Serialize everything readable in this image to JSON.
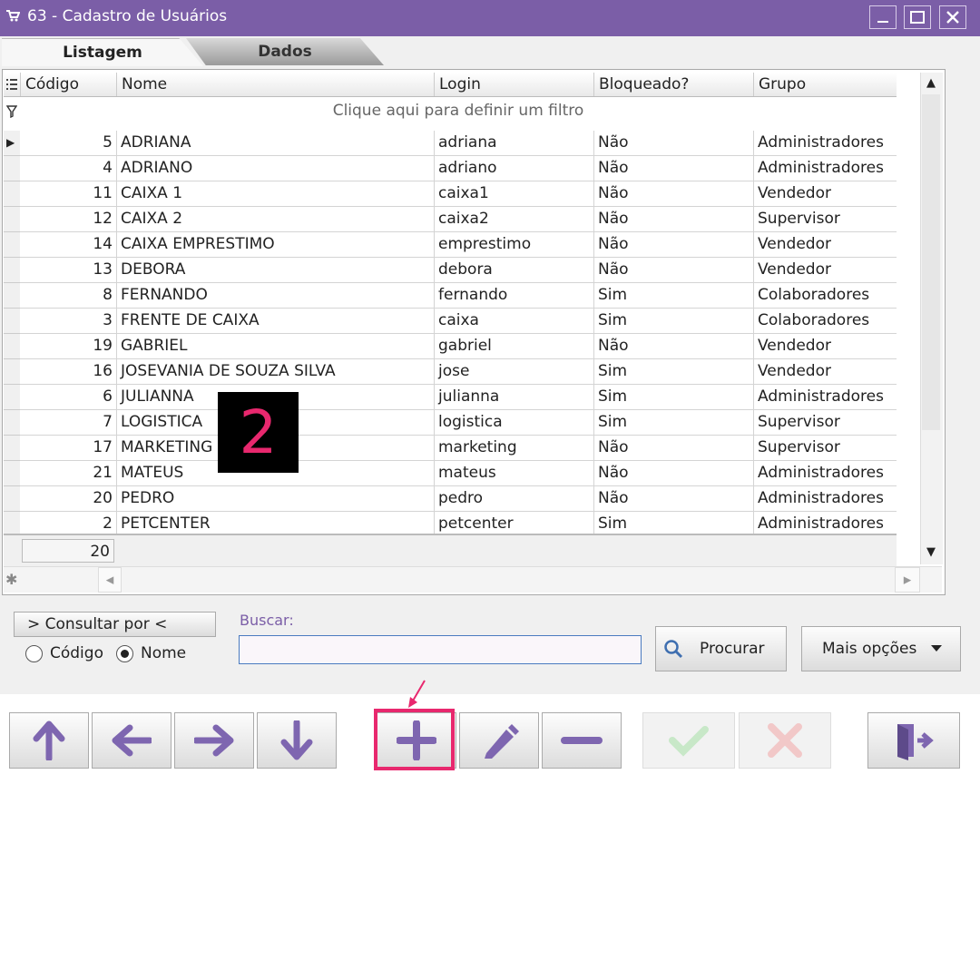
{
  "window": {
    "title": "63 - Cadastro de Usuários",
    "minimize_glyph": "▁",
    "maximize_glyph": "☐",
    "close_glyph": "✕"
  },
  "tabs": [
    {
      "label": "Listagem",
      "active": true
    },
    {
      "label": "Dados",
      "active": false
    }
  ],
  "grid": {
    "columns": [
      "Código",
      "Nome",
      "Login",
      "Bloqueado?",
      "Grupo"
    ],
    "filter_text": "Clique aqui para definir um filtro",
    "rows": [
      {
        "codigo": "5",
        "nome": "ADRIANA",
        "login": "adriana",
        "bloqueado": "Não",
        "grupo": "Administradores"
      },
      {
        "codigo": "4",
        "nome": "ADRIANO",
        "login": "adriano",
        "bloqueado": "Não",
        "grupo": "Administradores"
      },
      {
        "codigo": "11",
        "nome": "CAIXA 1",
        "login": "caixa1",
        "bloqueado": "Não",
        "grupo": "Vendedor"
      },
      {
        "codigo": "12",
        "nome": "CAIXA 2",
        "login": "caixa2",
        "bloqueado": "Não",
        "grupo": "Supervisor"
      },
      {
        "codigo": "14",
        "nome": "CAIXA EMPRESTIMO",
        "login": "emprestimo",
        "bloqueado": "Não",
        "grupo": "Vendedor"
      },
      {
        "codigo": "13",
        "nome": "DEBORA",
        "login": "debora",
        "bloqueado": "Não",
        "grupo": "Vendedor"
      },
      {
        "codigo": "8",
        "nome": "FERNANDO",
        "login": "fernando",
        "bloqueado": "Sim",
        "grupo": "Colaboradores"
      },
      {
        "codigo": "3",
        "nome": "FRENTE DE CAIXA",
        "login": "caixa",
        "bloqueado": "Sim",
        "grupo": "Colaboradores"
      },
      {
        "codigo": "19",
        "nome": "GABRIEL",
        "login": "gabriel",
        "bloqueado": "Não",
        "grupo": "Vendedor"
      },
      {
        "codigo": "16",
        "nome": "JOSEVANIA DE SOUZA SILVA",
        "login": "jose",
        "bloqueado": "Sim",
        "grupo": "Vendedor"
      },
      {
        "codigo": "6",
        "nome": "JULIANNA",
        "login": "julianna",
        "bloqueado": "Sim",
        "grupo": "Administradores"
      },
      {
        "codigo": "7",
        "nome": "LOGISTICA",
        "login": "logistica",
        "bloqueado": "Sim",
        "grupo": "Supervisor"
      },
      {
        "codigo": "17",
        "nome": "MARKETING",
        "login": "marketing",
        "bloqueado": "Não",
        "grupo": "Supervisor"
      },
      {
        "codigo": "21",
        "nome": "MATEUS",
        "login": "mateus",
        "bloqueado": "Não",
        "grupo": "Administradores"
      },
      {
        "codigo": "20",
        "nome": "PEDRO",
        "login": "pedro",
        "bloqueado": "Não",
        "grupo": "Administradores"
      },
      {
        "codigo": "2",
        "nome": "PETCENTER",
        "login": "petcenter",
        "bloqueado": "Sim",
        "grupo": "Administradores"
      }
    ],
    "footer_count": "20"
  },
  "search": {
    "consultar_label": "> Consultar por <",
    "radio_codigo": "Código",
    "radio_nome": "Nome",
    "selected": "Nome",
    "buscar_label": "Buscar:",
    "value": "",
    "procurar_label": "Procurar",
    "mais_opcoes_label": "Mais opções"
  },
  "toolbar": {
    "icons": [
      "arrow-up-icon",
      "arrow-left-icon",
      "arrow-right-icon",
      "arrow-down-icon",
      "plus-icon",
      "pencil-icon",
      "minus-icon",
      "check-icon",
      "x-icon",
      "exit-door-icon"
    ],
    "highlighted": "plus-icon"
  },
  "annotation": {
    "step_number": "2"
  },
  "colors": {
    "accent": "#7b5ea7",
    "icon": "#7e66b0",
    "highlight": "#e8286e",
    "disabled_check": "#c8e8c8",
    "disabled_x": "#f2c8c8"
  }
}
